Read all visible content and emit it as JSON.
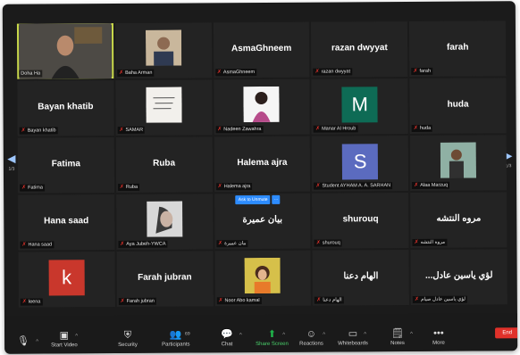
{
  "pagination": {
    "left": "1/3",
    "right": "1/3"
  },
  "tiles": [
    {
      "label": "Doha Ha",
      "kind": "video"
    },
    {
      "label": "Baha Arman",
      "kind": "photo"
    },
    {
      "title": "AsmaGhneem",
      "label": "AsmaGhneem",
      "kind": "name"
    },
    {
      "title": "razan dwyyat",
      "label": "razan dwyyat",
      "kind": "name"
    },
    {
      "title": "farah",
      "label": "farah",
      "kind": "name"
    },
    {
      "title": "Bayan khatib",
      "label": "Bayan khatib",
      "kind": "name"
    },
    {
      "label": "SAMAR",
      "kind": "photo"
    },
    {
      "label": "Nadeen Zawahra",
      "kind": "photo"
    },
    {
      "letter": "M",
      "color": "#0e6b55",
      "label": "Manar Al Hroub",
      "kind": "letter"
    },
    {
      "title": "huda",
      "label": "huda",
      "kind": "name"
    },
    {
      "title": "Fatima",
      "label": "Fatima",
      "kind": "name"
    },
    {
      "title": "Ruba",
      "label": "Ruba",
      "kind": "name"
    },
    {
      "title": "Halema ajra",
      "label": "Halema ajra",
      "kind": "name"
    },
    {
      "letter": "S",
      "color": "#5b6bbf",
      "label": "Student AYHAM A. A. SARHAN",
      "kind": "letter"
    },
    {
      "label": "Alaa Marzuq",
      "kind": "photo"
    },
    {
      "title": "Hana saad",
      "label": "Hana saad",
      "kind": "name"
    },
    {
      "label": "Aya Jubeh-YWCA",
      "kind": "photo"
    },
    {
      "title": "بيان عميرة",
      "label": "بيان عميرة",
      "kind": "name",
      "unmute": "Ask to Unmute",
      "more": "···"
    },
    {
      "title": "shurouq",
      "label": "shurouq",
      "kind": "name"
    },
    {
      "title": "مروه النتشه",
      "label": "مروه النتشه",
      "kind": "name"
    },
    {
      "letter": "k",
      "color": "#c9372c",
      "label": "leena",
      "kind": "letter"
    },
    {
      "title": "Farah jubran",
      "label": "Farah jubran",
      "kind": "name"
    },
    {
      "label": "Noor Abo kamal",
      "kind": "photo"
    },
    {
      "title": "الهام دعنا",
      "label": "الهام دعنا",
      "kind": "name"
    },
    {
      "title": "...لؤي ياسين عادل",
      "label": "لؤي ياسين عادل صيام",
      "kind": "name"
    }
  ],
  "toolbar": {
    "start_video": "Start Video",
    "security": "Security",
    "participants": "Participants",
    "participants_count": "69",
    "chat": "Chat",
    "share_screen": "Share Screen",
    "reactions": "Reactions",
    "whiteboards": "Whiteboards",
    "notes": "Notes",
    "more": "More",
    "end": "End"
  },
  "colors": {
    "accent": "#2d8cff",
    "share": "#1fb34a",
    "end": "#e0312a",
    "active_border": "#c9d94a"
  }
}
